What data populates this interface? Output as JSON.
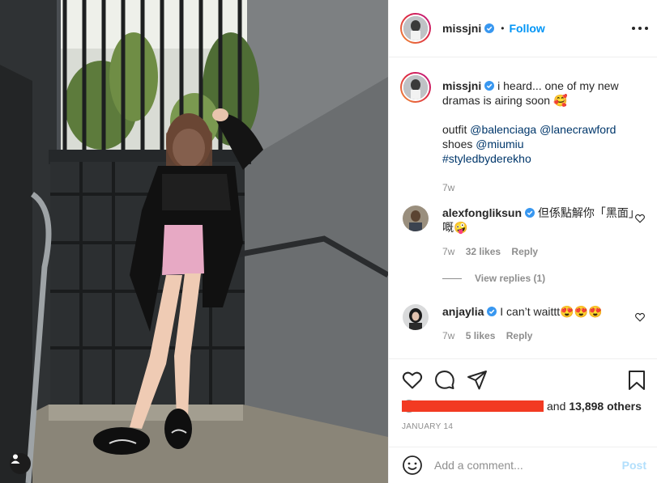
{
  "header": {
    "username": "missjni",
    "separator": "•",
    "follow_label": "Follow"
  },
  "caption": {
    "username": "missjni",
    "line1": "i heard... one of my new dramas is airing soon 🥰",
    "outfit_prefix": "outfit",
    "tag1": "@balenciaga",
    "tag2": "@lanecrawford",
    "shoes_prefix": "shoes",
    "tag3": "@miumiu",
    "hashtag": "#styledbyderekho",
    "time": "7w"
  },
  "comments": [
    {
      "username": "alexfongliksun",
      "text": "但係點解你「黑面」嘅🤪",
      "time": "7w",
      "likes": "32 likes",
      "reply_label": "Reply"
    },
    {
      "username": "anjaylia",
      "text": "I can’t waittt😍😍😍",
      "time": "7w",
      "likes": "5 likes",
      "reply_label": "Reply"
    }
  ],
  "view_replies": "View replies (1)",
  "likes": {
    "and_label": "and",
    "count": "13,898 others"
  },
  "date": "JANUARY 14",
  "composer": {
    "placeholder": "Add a comment...",
    "post_label": "Post"
  },
  "icons": {
    "verified": "verified-badge-icon",
    "more": "more-options-icon",
    "like": "heart-icon",
    "comment": "comment-icon",
    "share": "share-icon",
    "save": "bookmark-icon",
    "emoji": "emoji-icon",
    "tags": "user-tag-icon"
  },
  "colors": {
    "accent": "#0095f6",
    "link": "#00376b",
    "muted": "#8e8e8e",
    "redaction": "#f23a22",
    "verified": "#3897f0"
  }
}
